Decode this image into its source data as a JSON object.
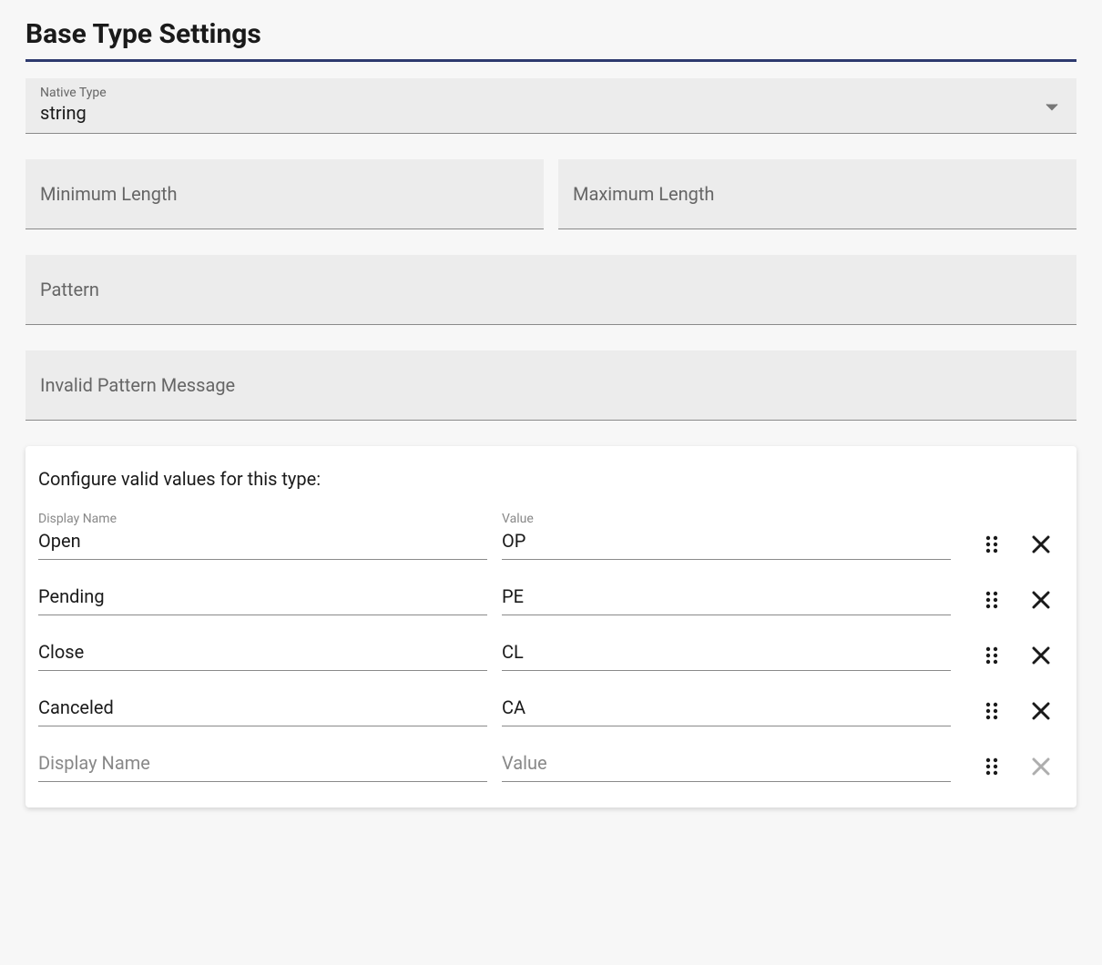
{
  "title": "Base Type Settings",
  "nativeType": {
    "label": "Native Type",
    "value": "string"
  },
  "fields": {
    "minLength": {
      "placeholder": "Minimum Length",
      "value": ""
    },
    "maxLength": {
      "placeholder": "Maximum Length",
      "value": ""
    },
    "pattern": {
      "placeholder": "Pattern",
      "value": ""
    },
    "invalidPatternMessage": {
      "placeholder": "Invalid Pattern Message",
      "value": ""
    }
  },
  "validValues": {
    "heading": "Configure valid values for this type:",
    "displayNameLabel": "Display Name",
    "valueLabel": "Value",
    "displayNamePlaceholder": "Display Name",
    "valuePlaceholder": "Value",
    "rows": [
      {
        "displayName": "Open",
        "value": "OP"
      },
      {
        "displayName": "Pending",
        "value": "PE"
      },
      {
        "displayName": "Close",
        "value": "CL"
      },
      {
        "displayName": "Canceled",
        "value": "CA"
      }
    ]
  }
}
